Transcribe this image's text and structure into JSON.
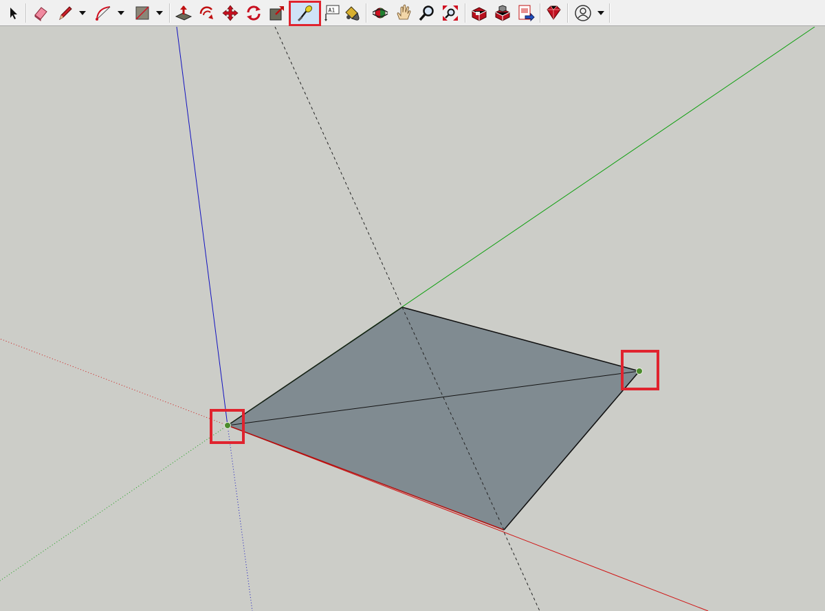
{
  "app": "SketchUp",
  "toolbar": {
    "tools": [
      {
        "name": "select-tool",
        "icon": "arrow-icon"
      },
      {
        "name": "eraser-tool",
        "icon": "eraser-icon"
      },
      {
        "name": "line-tool",
        "icon": "pencil-icon",
        "dropdown": true
      },
      {
        "name": "arc-tool",
        "icon": "arc-icon",
        "dropdown": true
      },
      {
        "name": "shape-tool",
        "icon": "rectangle-icon",
        "dropdown": true
      },
      {
        "name": "push-pull-tool",
        "icon": "push-pull-icon"
      },
      {
        "name": "offset-tool",
        "icon": "offset-icon"
      },
      {
        "name": "move-tool",
        "icon": "move-icon"
      },
      {
        "name": "rotate-tool",
        "icon": "rotate-icon"
      },
      {
        "name": "scale-tool",
        "icon": "scale-icon"
      },
      {
        "name": "tape-measure-tool",
        "icon": "tape-measure-icon",
        "active": true
      },
      {
        "name": "text-tool",
        "icon": "text-icon"
      },
      {
        "name": "paint-bucket-tool",
        "icon": "paint-bucket-icon"
      },
      {
        "name": "orbit-tool",
        "icon": "orbit-icon"
      },
      {
        "name": "pan-tool",
        "icon": "hand-icon"
      },
      {
        "name": "zoom-tool",
        "icon": "magnifier-icon"
      },
      {
        "name": "zoom-extents-tool",
        "icon": "zoom-extents-icon"
      },
      {
        "name": "3d-warehouse-button",
        "icon": "warehouse-icon"
      },
      {
        "name": "extension-warehouse-button",
        "icon": "extension-warehouse-icon"
      },
      {
        "name": "send-to-layout-button",
        "icon": "layout-icon"
      },
      {
        "name": "ruby-console-button",
        "icon": "ruby-icon"
      },
      {
        "name": "account-button",
        "icon": "user-icon",
        "dropdown": true
      }
    ],
    "text_tool_glyph": "A1"
  },
  "viewport": {
    "background": "#cccdc8",
    "face_color": "#808b91",
    "axis_colors": {
      "red": "#d01010",
      "green": "#10a010",
      "blue": "#1010c0"
    },
    "highlight_color": "#e0232e",
    "selected_point_color": "#4a8a2c"
  }
}
